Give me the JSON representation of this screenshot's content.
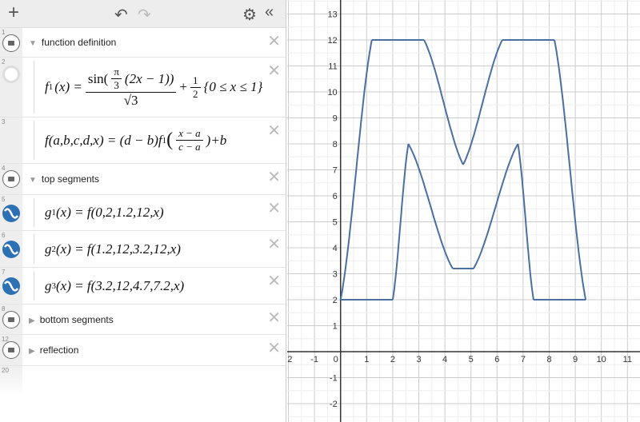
{
  "toolbar": {
    "add": "+",
    "undo": "↶",
    "redo": "↷",
    "settings": "⚙",
    "collapse": "«"
  },
  "rows": [
    {
      "num": "1",
      "type": "folder",
      "label": "function definition",
      "expanded": true
    },
    {
      "num": "2",
      "type": "hidden-expression",
      "lhs": "f",
      "sub": "1",
      "arg": "(x) =",
      "num_a": "sin(",
      "pi_n": "π",
      "pi_d": "3",
      "num_b": "(2x − 1))",
      "den": "√3",
      "plus": "+",
      "half_n": "1",
      "half_d": "2",
      "cond": "{0 ≤ x ≤ 1}"
    },
    {
      "num": "3",
      "type": "expression",
      "lhs": "f(a,b,c,d,x) = (d − b)f",
      "sub": "1",
      "open": "(",
      "fn": "x − a",
      "fd": "c − a",
      "close": ")+b"
    },
    {
      "num": "4",
      "type": "folder",
      "label": "top segments",
      "expanded": true
    },
    {
      "num": "5",
      "type": "expression",
      "lhs": "g",
      "sub": "1",
      "rhs": "(x) = f(0,2,1.2,12,x)"
    },
    {
      "num": "6",
      "type": "expression",
      "lhs": "g",
      "sub": "2",
      "rhs": "(x) = f(1.2,12,3.2,12,x)"
    },
    {
      "num": "7",
      "type": "expression",
      "lhs": "g",
      "sub": "3",
      "rhs": "(x) = f(3.2,12,4.7,7.2,x)"
    },
    {
      "num": "8",
      "type": "folder",
      "label": "bottom segments",
      "expanded": false
    },
    {
      "num": "12",
      "type": "folder",
      "label": "reflection",
      "expanded": false
    },
    {
      "num": "20",
      "type": "empty"
    }
  ],
  "colors": {
    "curve": "#4a6fa0",
    "accent": "#2d70b3"
  },
  "graph": {
    "xlim": [
      -2,
      11.5
    ],
    "ylim": [
      -2.7,
      13.6
    ],
    "xticks": [
      -2,
      -1,
      0,
      1,
      2,
      3,
      4,
      5,
      6,
      7,
      8,
      9,
      10,
      11
    ],
    "yticks": [
      -2,
      -1,
      1,
      2,
      3,
      4,
      5,
      6,
      7,
      8,
      9,
      10,
      11,
      12,
      13
    ],
    "segments": [
      [
        0,
        2,
        1.2,
        12
      ],
      [
        1.2,
        12,
        3.2,
        12
      ],
      [
        3.2,
        12,
        4.7,
        7.2
      ],
      [
        0,
        2,
        2,
        2
      ],
      [
        2,
        2,
        2.6,
        8
      ],
      [
        2.6,
        8,
        4.3,
        3.2
      ],
      [
        4.3,
        3.2,
        4.7,
        3.2
      ]
    ],
    "reflection_axis": 4.7
  }
}
